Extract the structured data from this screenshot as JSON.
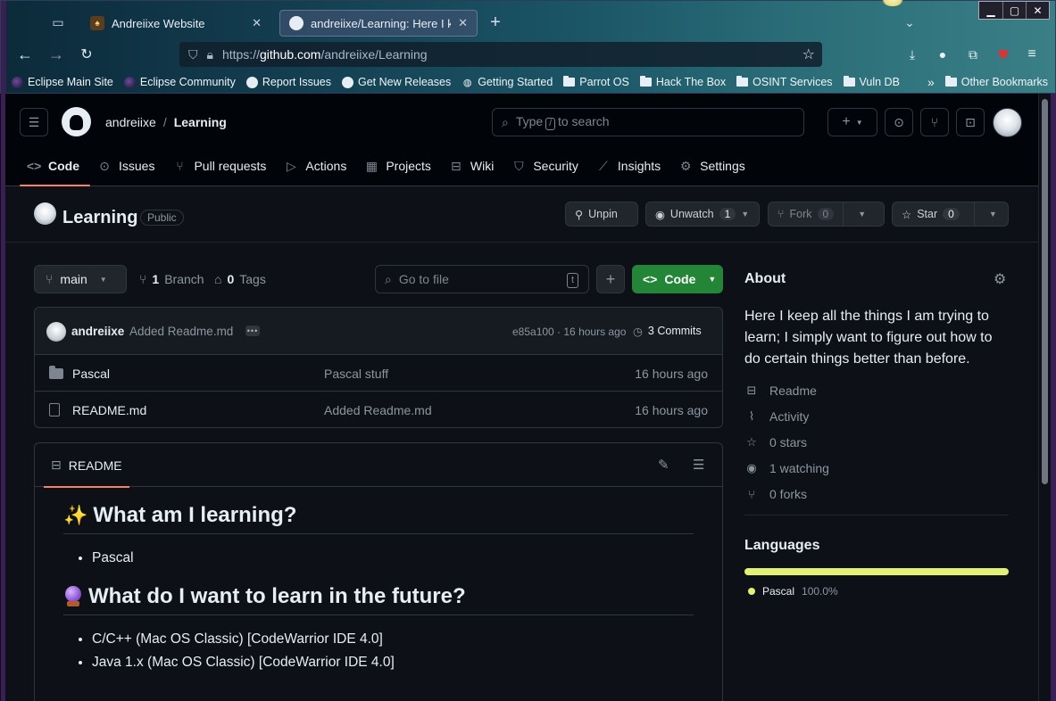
{
  "browser": {
    "tabs": [
      {
        "label": "Andreiixe Website",
        "active": false
      },
      {
        "label": "andreiixe/Learning: Here I keep",
        "active": true
      }
    ],
    "url_scheme": "https://",
    "url_host": "github.com",
    "url_path": "/andreiixe/Learning",
    "bookmarks": [
      {
        "label": "Eclipse Main Site",
        "icon": "eclipse-icon"
      },
      {
        "label": "Eclipse Community",
        "icon": "eclipse-icon"
      },
      {
        "label": "Report Issues",
        "icon": "github-icon"
      },
      {
        "label": "Get New Releases",
        "icon": "github-icon"
      },
      {
        "label": "Getting Started",
        "icon": "globe-icon"
      },
      {
        "label": "Parrot OS",
        "icon": "folder-icon"
      },
      {
        "label": "Hack The Box",
        "icon": "folder-icon"
      },
      {
        "label": "OSINT Services",
        "icon": "folder-icon"
      },
      {
        "label": "Vuln DB",
        "icon": "folder-icon"
      }
    ],
    "other_bookmarks": "Other Bookmarks"
  },
  "header": {
    "owner": "andreiixe",
    "separator": "/",
    "repo": "Learning",
    "search_prefix": "Type",
    "search_key": "/",
    "search_suffix": "to search"
  },
  "repo_nav": [
    {
      "label": "Code",
      "icon": "code-icon",
      "selected": true
    },
    {
      "label": "Issues",
      "icon": "issue-icon"
    },
    {
      "label": "Pull requests",
      "icon": "pull-request-icon"
    },
    {
      "label": "Actions",
      "icon": "play-icon"
    },
    {
      "label": "Projects",
      "icon": "table-icon"
    },
    {
      "label": "Wiki",
      "icon": "book-icon"
    },
    {
      "label": "Security",
      "icon": "shield-icon"
    },
    {
      "label": "Insights",
      "icon": "graph-icon"
    },
    {
      "label": "Settings",
      "icon": "gear-icon"
    }
  ],
  "repo": {
    "name": "Learning",
    "visibility": "Public",
    "unpin": "Unpin",
    "unwatch": "Unwatch",
    "watch_count": "1",
    "fork": "Fork",
    "fork_count": "0",
    "star": "Star",
    "star_count": "0"
  },
  "toolbar": {
    "branch": "main",
    "branch_count": "1",
    "branch_label": "Branch",
    "tag_count": "0",
    "tag_label": "Tags",
    "goto_placeholder": "Go to file",
    "goto_key": "t",
    "code_label": "Code"
  },
  "commit": {
    "author": "andreiixe",
    "message": "Added Readme.md",
    "hash_time": "e85a100 · 16 hours ago",
    "commits": "3 Commits"
  },
  "files": [
    {
      "name": "Pascal",
      "type": "dir",
      "message": "Pascal stuff",
      "time": "16 hours ago"
    },
    {
      "name": "README.md",
      "type": "file",
      "message": "Added Readme.md",
      "time": "16 hours ago"
    }
  ],
  "readme": {
    "tab": "README",
    "h1": "What am I learning?",
    "list1": [
      "Pascal"
    ],
    "h2": "What do I want to learn in the future?",
    "list2": [
      "C/C++ (Mac OS Classic) [CodeWarrior IDE 4.0]",
      "Java 1.x (Mac OS Classic) [CodeWarrior IDE 4.0]"
    ]
  },
  "about": {
    "title": "About",
    "description": "Here I keep all the things I am trying to learn; I simply want to figure out how to do certain things better than before.",
    "links": [
      {
        "label": "Readme",
        "icon": "book-icon"
      },
      {
        "label": "Activity",
        "icon": "pulse-icon"
      },
      {
        "label": "0 stars",
        "icon": "star-icon"
      },
      {
        "label": "1 watching",
        "icon": "eye-icon"
      },
      {
        "label": "0 forks",
        "icon": "fork-icon"
      }
    ]
  },
  "languages": {
    "title": "Languages",
    "items": [
      {
        "name": "Pascal",
        "percent": "100.0%",
        "color": "#e3f171"
      }
    ]
  }
}
